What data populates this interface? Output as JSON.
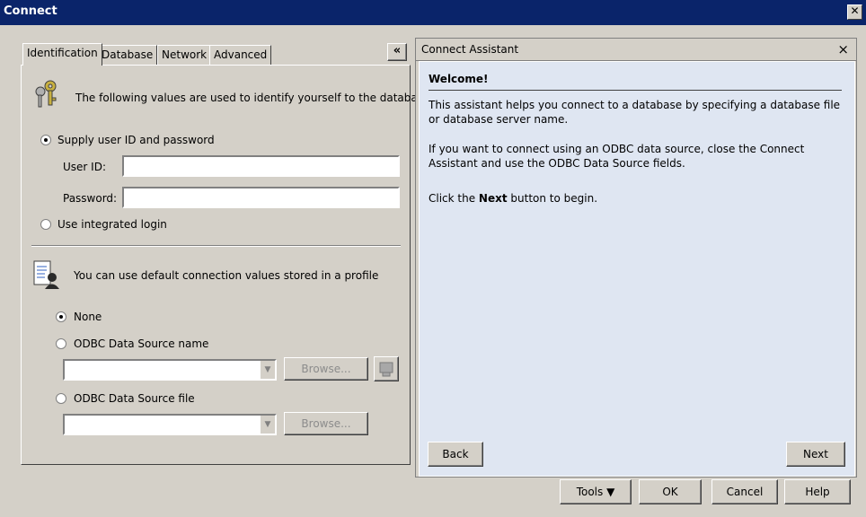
{
  "window": {
    "title": "Connect",
    "close_glyph": "✕"
  },
  "tabs": [
    {
      "label": "Identification",
      "active": true
    },
    {
      "label": "Database"
    },
    {
      "label": "Network"
    },
    {
      "label": "Advanced"
    }
  ],
  "identification": {
    "intro": "The following values are used to identify yourself to the database",
    "supply_radio_label": "Supply user ID and password",
    "user_id_label": "User ID:",
    "user_id_value": "",
    "password_label": "Password:",
    "password_value": "",
    "integrated_label": "Use integrated login",
    "profile_intro": "You can use default connection values stored in a profile",
    "none_label": "None",
    "odbc_name_label": "ODBC Data Source name",
    "odbc_file_label": "ODBC Data Source file",
    "browse_label": "Browse...",
    "selected_auth": "supply",
    "selected_profile": "none"
  },
  "assistant": {
    "title": "Connect Assistant",
    "close_glyph": "×",
    "heading": "Welcome!",
    "para1": "This assistant helps you connect to a database by specifying a database file or database server name.",
    "para2": "If you want to connect using an ODBC data source, close the Connect Assistant and use the ODBC Data Source fields.",
    "para3_prefix": "Click the ",
    "para3_bold": "Next",
    "para3_suffix": " button to begin.",
    "back_label": "Back",
    "next_label": "Next",
    "collapse_glyph": "«"
  },
  "footer": {
    "tools_label": "Tools",
    "ok_label": "OK",
    "cancel_label": "Cancel",
    "help_label": "Help"
  },
  "icons": [
    "keys-icon",
    "profile-document-icon",
    "collapse-chevron-icon",
    "odbc-admin-icon",
    "dropdown-arrow-icon"
  ]
}
